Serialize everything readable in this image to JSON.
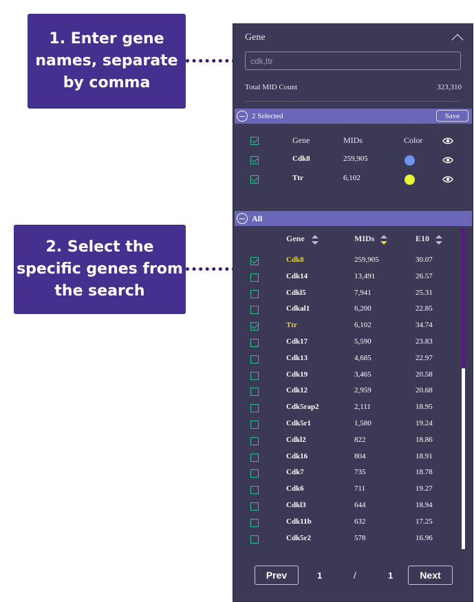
{
  "callouts": {
    "step1": "1. Enter gene\nnames, separate\nby comma",
    "step2": "2. Select the\nspecific genes from\nthe search"
  },
  "panel": {
    "title": "Gene",
    "search": {
      "value": "",
      "placeholder": "cdk,ttr"
    },
    "total_label": "Total MID Count",
    "total_value": "323,310"
  },
  "selected": {
    "label": "2 Selected",
    "save_label": "Save",
    "headers": {
      "gene": "Gene",
      "mids": "MIDs",
      "color": "Color"
    },
    "rows": [
      {
        "gene": "Cdk8",
        "mids": "259,905",
        "color": "#6f94f0"
      },
      {
        "gene": "Ttr",
        "mids": "6,102",
        "color": "#e4f53a"
      }
    ]
  },
  "all": {
    "label": "All",
    "headers": {
      "gene": "Gene",
      "mids": "MIDs",
      "e10": "E10"
    },
    "active_sort_color": "#e9d42a",
    "rows": [
      {
        "gene": "Cdk8",
        "mids": "259,905",
        "e10": "30.07",
        "checked": true
      },
      {
        "gene": "Cdk14",
        "mids": "13,491",
        "e10": "26.57",
        "checked": false
      },
      {
        "gene": "Cdkl5",
        "mids": "7,941",
        "e10": "25.31",
        "checked": false
      },
      {
        "gene": "Cdkal1",
        "mids": "6,200",
        "e10": "22.85",
        "checked": false
      },
      {
        "gene": "Ttr",
        "mids": "6,102",
        "e10": "34.74",
        "checked": true
      },
      {
        "gene": "Cdk17",
        "mids": "5,590",
        "e10": "23.83",
        "checked": false
      },
      {
        "gene": "Cdk13",
        "mids": "4,685",
        "e10": "22.97",
        "checked": false
      },
      {
        "gene": "Cdk19",
        "mids": "3,465",
        "e10": "20.58",
        "checked": false
      },
      {
        "gene": "Cdk12",
        "mids": "2,959",
        "e10": "20.68",
        "checked": false
      },
      {
        "gene": "Cdk5rap2",
        "mids": "2,111",
        "e10": "18.95",
        "checked": false
      },
      {
        "gene": "Cdk5r1",
        "mids": "1,580",
        "e10": "19.24",
        "checked": false
      },
      {
        "gene": "Cdkl2",
        "mids": "822",
        "e10": "18.86",
        "checked": false
      },
      {
        "gene": "Cdk16",
        "mids": "804",
        "e10": "18.91",
        "checked": false
      },
      {
        "gene": "Cdk7",
        "mids": "735",
        "e10": "18.78",
        "checked": false
      },
      {
        "gene": "Cdk6",
        "mids": "711",
        "e10": "19.27",
        "checked": false
      },
      {
        "gene": "Cdkl3",
        "mids": "644",
        "e10": "18.94",
        "checked": false
      },
      {
        "gene": "Cdk11b",
        "mids": "632",
        "e10": "17.25",
        "checked": false
      },
      {
        "gene": "Cdk5r2",
        "mids": "578",
        "e10": "16.96",
        "checked": false
      }
    ]
  },
  "pager": {
    "prev": "Prev",
    "next": "Next",
    "current": "1",
    "separator": "/",
    "total": "1"
  }
}
